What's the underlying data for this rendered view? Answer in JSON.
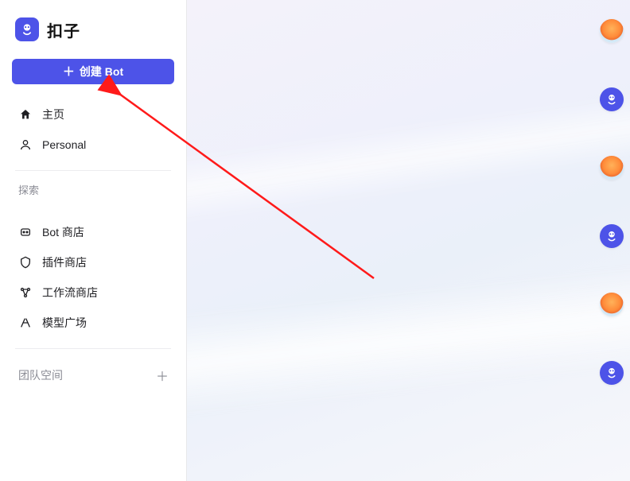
{
  "brand": {
    "name": "扣子"
  },
  "sidebar": {
    "create_label": "创建 Bot",
    "nav": {
      "home": "主页",
      "personal": "Personal"
    },
    "explore": {
      "label": "探索",
      "bot_store": "Bot 商店",
      "plugin_store": "插件商店",
      "workflow_store": "工作流商店",
      "model_plaza": "模型广场"
    },
    "team": {
      "label": "团队空间"
    }
  },
  "dock": {
    "items": [
      {
        "kind": "balloon",
        "name": "avatar-1"
      },
      {
        "kind": "bot",
        "name": "avatar-bot-1"
      },
      {
        "kind": "balloon",
        "name": "avatar-2"
      },
      {
        "kind": "bot",
        "name": "avatar-bot-2"
      },
      {
        "kind": "balloon",
        "name": "avatar-3"
      },
      {
        "kind": "bot",
        "name": "avatar-bot-3"
      }
    ]
  },
  "colors": {
    "primary": "#4d53e8",
    "annotation": "#ff1a1a"
  }
}
